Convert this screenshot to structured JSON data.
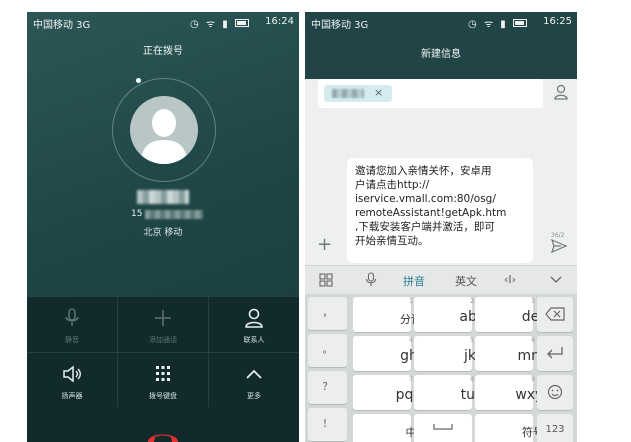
{
  "left": {
    "status": {
      "carrier": "中国移动 3G",
      "time": "16:24"
    },
    "title": "正在拨号",
    "caller": {
      "number_prefix": "15",
      "location": "北京 移动"
    },
    "controls": [
      {
        "label": "静音",
        "icon": "microphone-icon"
      },
      {
        "label": "添加通话",
        "icon": "plus-icon"
      },
      {
        "label": "联系人",
        "icon": "contact-icon"
      },
      {
        "label": "扬声器",
        "icon": "speaker-icon"
      },
      {
        "label": "拨号键盘",
        "icon": "dialpad-icon"
      },
      {
        "label": "更多",
        "icon": "chevron-up-icon"
      }
    ],
    "hangup_color": "#e0332e"
  },
  "right": {
    "status": {
      "carrier": "中国移动 3G",
      "time": "16:25"
    },
    "title": "新建信息",
    "recipient_chip_close": "×",
    "message_lines": [
      "邀请您加入亲情关怀，安卓用",
      "户请点击http://",
      "iservice.vmall.com:80/osg/",
      "remoteAssistant!getApk.htm",
      ",下载安装客户端并激活，即可",
      "开始亲情互动。"
    ],
    "add_symbol": "+",
    "char_count": "36/2",
    "keyboard_toolbar": {
      "mode": "拼音",
      "english": "英文",
      "cursor": "‹I›"
    },
    "keyboard": {
      "side_keys": [
        "，",
        "。",
        "？",
        "！"
      ],
      "rows": [
        [
          {
            "num": "1",
            "label": "分词"
          },
          {
            "num": "2",
            "label": "abc"
          },
          {
            "num": "3",
            "label": "def"
          }
        ],
        [
          {
            "num": "4",
            "label": "ghi"
          },
          {
            "num": "5",
            "label": "jkl"
          },
          {
            "num": "6",
            "label": "mno"
          }
        ],
        [
          {
            "num": "7",
            "label": "pqrs"
          },
          {
            "num": "8",
            "label": "tuv"
          },
          {
            "num": "9",
            "label": "wxyz"
          }
        ],
        [
          {
            "num": "",
            "label": "中"
          },
          {
            "num": "",
            "label": ""
          },
          {
            "num": "",
            "label": "符号"
          }
        ]
      ],
      "bottom_right": "123"
    },
    "accent_color": "#214446"
  }
}
